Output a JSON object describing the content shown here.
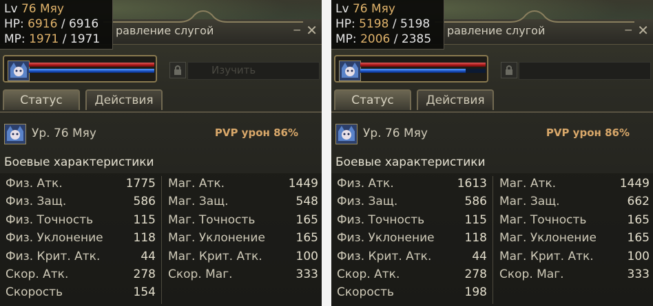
{
  "panels": [
    {
      "tooltip": {
        "lv_label": "Lv",
        "lv_value": "76",
        "lv_name": "Мяу",
        "hp_label": "HP:",
        "hp_cur": "6916",
        "hp_sep": "/",
        "hp_max": "6916",
        "mp_label": "MP:",
        "mp_cur": "1971",
        "mp_sep": "/",
        "mp_max": "1971"
      },
      "title": "равление слугой",
      "hp_fraction": 1.0,
      "mp_fraction": 1.0,
      "bg_label": "Изучить",
      "tabs": [
        "Статус",
        "Действия"
      ],
      "level": "Ур. 76 Мяу",
      "pvp": "PVP урон 86%",
      "section": "Боевые характеристики",
      "left_stats": [
        {
          "label": "Физ. Атк.",
          "value": "1775"
        },
        {
          "label": "Физ. Защ.",
          "value": "586"
        },
        {
          "label": "Физ. Точность",
          "value": "115"
        },
        {
          "label": "Физ. Уклонение",
          "value": "118"
        },
        {
          "label": "Физ. Крит. Атк.",
          "value": "44"
        },
        {
          "label": "Скор. Атк.",
          "value": "278"
        },
        {
          "label": "Скорость",
          "value": "154"
        }
      ],
      "right_stats": [
        {
          "label": "Маг. Атк.",
          "value": "1449"
        },
        {
          "label": "Маг. Защ.",
          "value": "548"
        },
        {
          "label": "Маг. Точность",
          "value": "165"
        },
        {
          "label": "Маг. Уклонение",
          "value": "165"
        },
        {
          "label": "Маг. Крит. Атк.",
          "value": "100"
        },
        {
          "label": "Скор. Маг.",
          "value": "333"
        }
      ]
    },
    {
      "tooltip": {
        "lv_label": "Lv",
        "lv_value": "76",
        "lv_name": "Мяу",
        "hp_label": "HP:",
        "hp_cur": "5198",
        "hp_sep": "/",
        "hp_max": "5198",
        "mp_label": "MP:",
        "mp_cur": "2006",
        "mp_sep": "/",
        "mp_max": "2385"
      },
      "title": "равление слугой",
      "hp_fraction": 1.0,
      "mp_fraction": 0.84,
      "bg_label": "",
      "tabs": [
        "Статус",
        "Действия"
      ],
      "level": "Ур. 76 Мяу",
      "pvp": "PVP урон 86%",
      "section": "Боевые характеристики",
      "left_stats": [
        {
          "label": "Физ. Атк.",
          "value": "1613"
        },
        {
          "label": "Физ. Защ.",
          "value": "586"
        },
        {
          "label": "Физ. Точность",
          "value": "115"
        },
        {
          "label": "Физ. Уклонение",
          "value": "118"
        },
        {
          "label": "Физ. Крит. Атк.",
          "value": "44"
        },
        {
          "label": "Скор. Атк.",
          "value": "278"
        },
        {
          "label": "Скорость",
          "value": "198"
        }
      ],
      "right_stats": [
        {
          "label": "Маг. Атк.",
          "value": "1449"
        },
        {
          "label": "Маг. Защ.",
          "value": "662"
        },
        {
          "label": "Маг. Точность",
          "value": "165"
        },
        {
          "label": "Маг. Уклонение",
          "value": "165"
        },
        {
          "label": "Маг. Крит. Атк.",
          "value": "100"
        },
        {
          "label": "Скор. Маг.",
          "value": "333"
        }
      ]
    }
  ]
}
